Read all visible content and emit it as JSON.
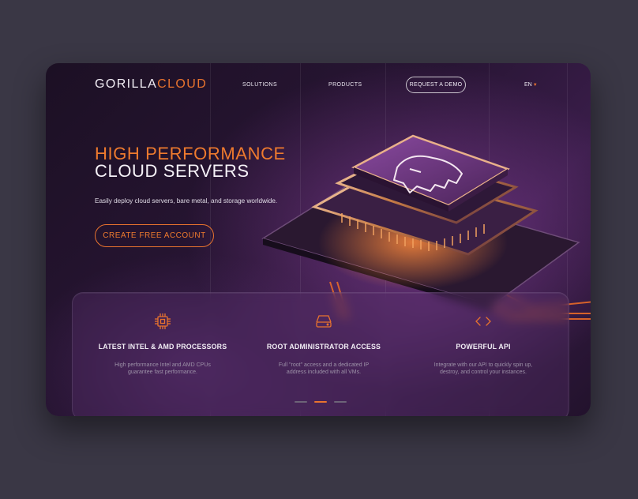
{
  "brand": {
    "part1": "GORILLA",
    "part2": "CLOUD"
  },
  "nav": {
    "solutions": "SOLUTIONS",
    "products": "PRODUCTS",
    "demo": "REQUEST A DEMO",
    "lang": "EN"
  },
  "hero": {
    "title_line1": "HIGH PERFORMANCE",
    "title_line2": "CLOUD SERVERS",
    "subtitle": "Easily deploy cloud servers, bare metal, and storage worldwide.",
    "cta": "CREATE FREE ACCOUNT"
  },
  "features": [
    {
      "icon": "processor-chip-icon",
      "title": "LATEST INTEL & AMD PROCESSORS",
      "desc_line1": "High performance Intel and AMD CPUs",
      "desc_line2": "guarantee fast performance."
    },
    {
      "icon": "server-drive-icon",
      "title": "ROOT ADMINISTRATOR ACCESS",
      "desc_line1": "Full \"root\" access and a dedicated IP",
      "desc_line2": "address included with all VMs."
    },
    {
      "icon": "code-brackets-icon",
      "title": "POWERFUL API",
      "desc_line1": "Integrate with our API to quickly spin up,",
      "desc_line2": "destroy, and control your instances."
    }
  ],
  "carousel": {
    "active_index": 1,
    "count": 3
  },
  "colors": {
    "accent": "#e8732e",
    "background": "#3a3745",
    "card_dark": "#1c1024",
    "purple": "#7a3f8f"
  }
}
